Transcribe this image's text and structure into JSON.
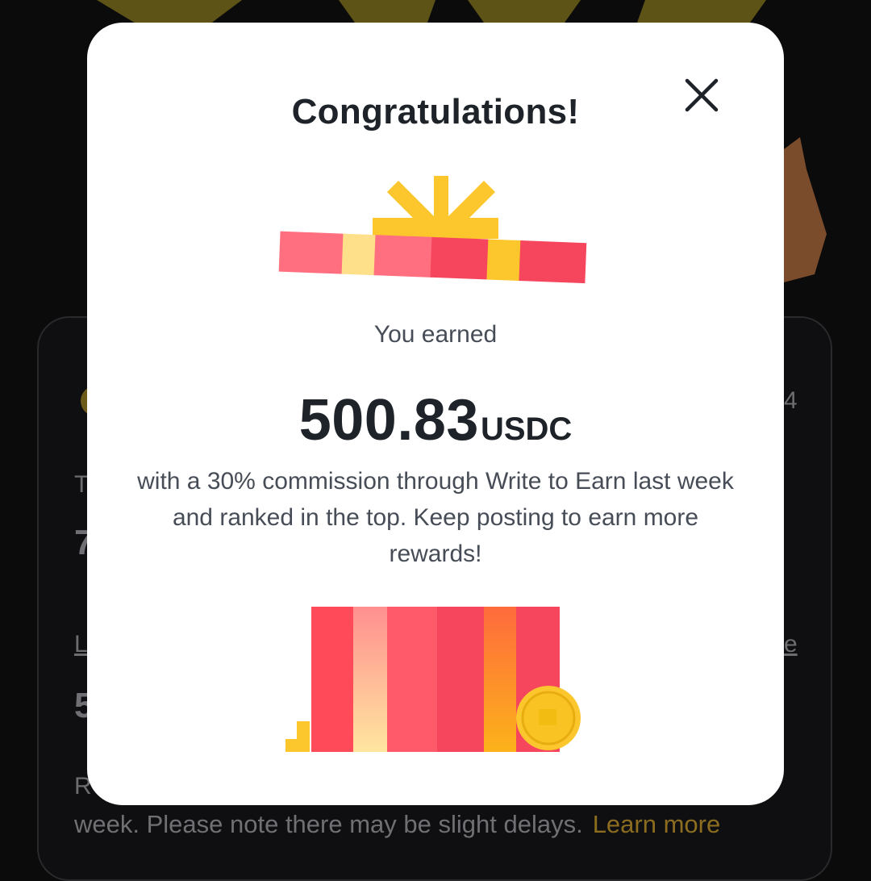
{
  "background": {
    "footer_text": "week. Please note there may be slight delays.",
    "learn_more": "Learn more",
    "frag_t": "T",
    "frag_7": "7",
    "frag_l": "L",
    "frag_5": "5",
    "frag_r": "R",
    "frag_4": "4",
    "frag_e": "e"
  },
  "modal": {
    "title": "Congratulations!",
    "close_icon": "close-icon",
    "earned_label": "You earned",
    "amount": "500.83",
    "unit": "USDC",
    "message": "with a 30% commission through Write to Earn last week and ranked in the top. Keep posting to earn more rewards!"
  },
  "colors": {
    "accent_link": "#8c6d1f",
    "gift_red": "#f6465d",
    "gift_pink": "#ff6f7f",
    "gift_yellow": "#fcd535",
    "coin_gold": "#f0b90b"
  }
}
